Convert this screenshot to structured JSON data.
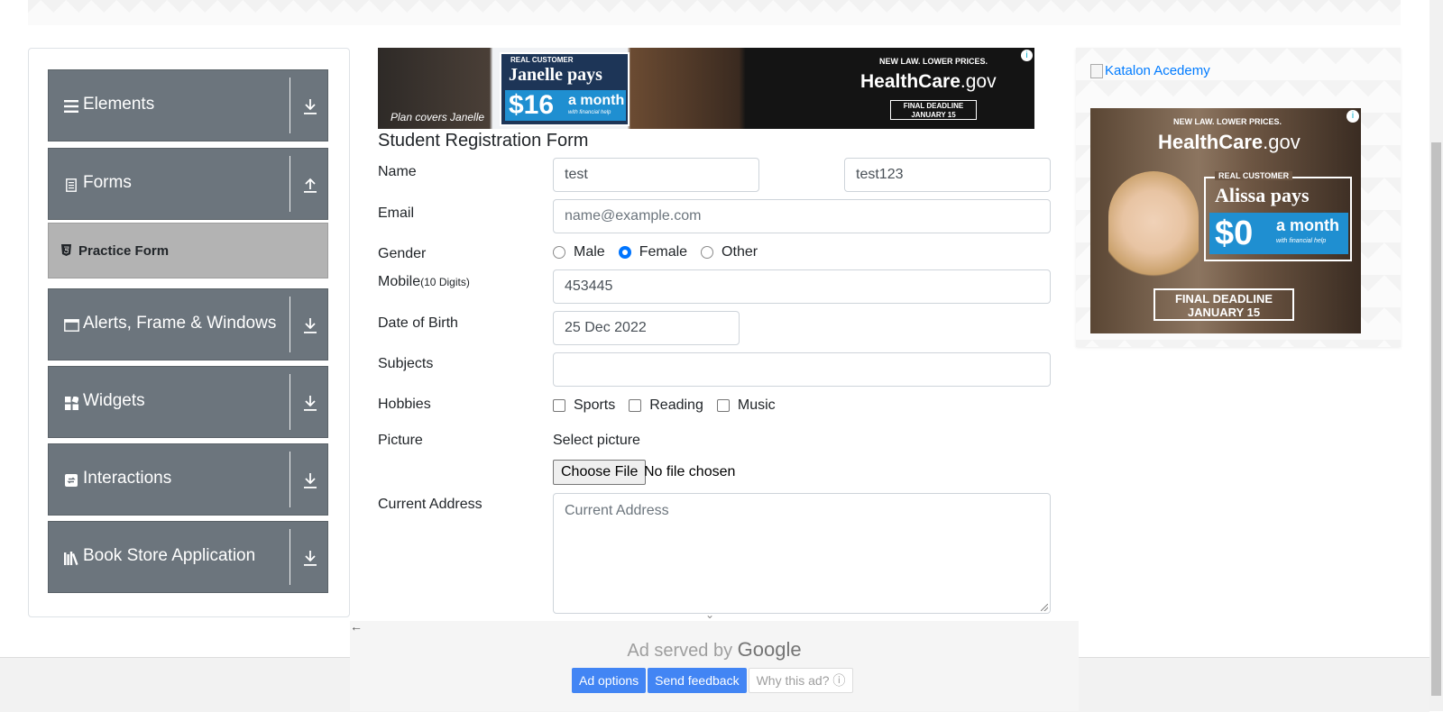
{
  "sidebar": {
    "groups": [
      {
        "label": "Elements",
        "icon": "menu-bars-icon"
      },
      {
        "label": "Forms",
        "icon": "document-icon"
      },
      {
        "label": "Alerts, Frame & Windows",
        "icon": "window-icon"
      },
      {
        "label": "Widgets",
        "icon": "widgets-icon"
      },
      {
        "label": "Interactions",
        "icon": "interactions-icon"
      },
      {
        "label": "Book Store Application",
        "icon": "books-icon"
      }
    ],
    "active_item": {
      "label": "Practice Form",
      "icon": "html5-icon"
    }
  },
  "ad_top": {
    "caption": "Plan covers Janelle",
    "real_customer": "REAL CUSTOMER",
    "pays": "Janelle pays",
    "price": "$16",
    "per_month": "a month",
    "financial_help": "with financial help",
    "tagline": "NEW LAW. LOWER PRICES.",
    "brand_main": "HealthCare",
    "brand_suffix": ".gov",
    "deadline_1": "FINAL DEADLINE",
    "deadline_2": "JANUARY 15"
  },
  "form": {
    "title": "Student Registration Form",
    "name_label": "Name",
    "first_name": "test",
    "last_name": "test123",
    "email_label": "Email",
    "email_placeholder": "name@example.com",
    "gender_label": "Gender",
    "gender_options": [
      "Male",
      "Female",
      "Other"
    ],
    "gender_selected": "Female",
    "mobile_label": "Mobile",
    "mobile_hint": "(10 Digits)",
    "mobile_value": "453445",
    "dob_label": "Date of Birth",
    "dob_value": "25 Dec 2022",
    "subjects_label": "Subjects",
    "subjects_value": "",
    "hobbies_label": "Hobbies",
    "hobbies_options": [
      "Sports",
      "Reading",
      "Music"
    ],
    "picture_label": "Picture",
    "select_picture": "Select picture",
    "choose_file": "Choose File",
    "file_status": "No file chosen",
    "address_label": "Current Address",
    "address_placeholder": "Current Address"
  },
  "ad_right": {
    "broken_image_alt": "Katalon Acedemy",
    "tagline": "NEW LAW. LOWER PRICES.",
    "brand_main": "HealthCare",
    "brand_suffix": ".gov",
    "real_customer": "REAL CUSTOMER",
    "pays": "Alissa pays",
    "price": "$0",
    "per_month": "a month",
    "financial_help": "with financial help",
    "deadline_1": "FINAL DEADLINE",
    "deadline_2": "JANUARY 15"
  },
  "google_ad": {
    "served_prefix": "Ad served by",
    "served_brand": "Google",
    "ad_options": "Ad options",
    "send_feedback": "Send feedback",
    "why_this_ad": "Why this ad?"
  },
  "colors": {
    "sidebar_group": "#6c757d",
    "active_item": "#b3b3b3",
    "link": "#007bff",
    "radio_selected": "#0075ff",
    "google_button": "#4285f4"
  }
}
